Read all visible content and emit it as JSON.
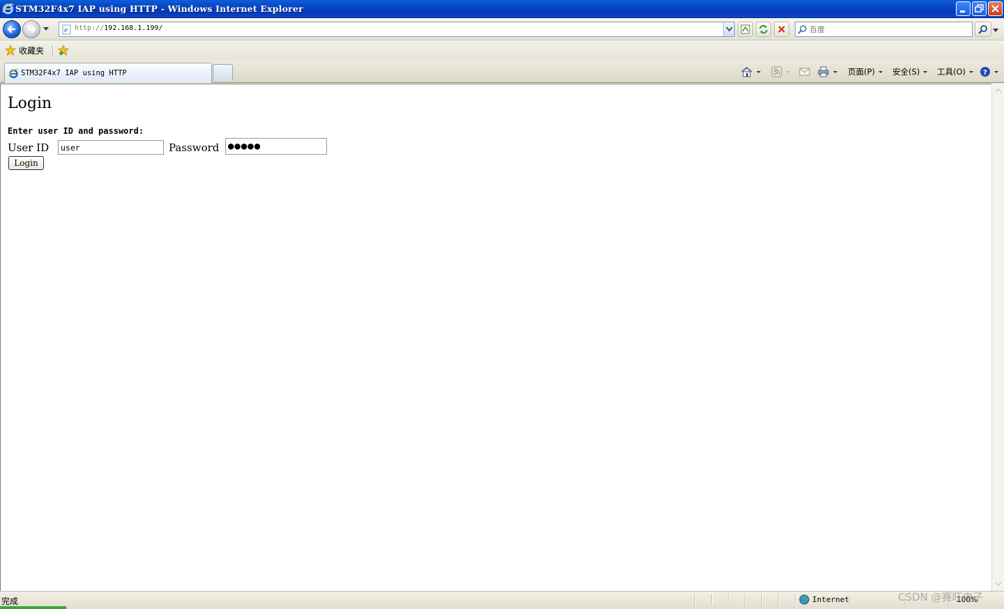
{
  "window": {
    "title": "STM32F4x7 IAP using HTTP - Windows Internet Explorer"
  },
  "navbar": {
    "url_scheme": "http://",
    "url_host": "192.168.1.199/",
    "search_placeholder": "百度"
  },
  "favorites": {
    "label": "收藏夹"
  },
  "tabs": [
    {
      "title": "STM32F4x7 IAP using HTTP"
    }
  ],
  "command_bar": {
    "page_label": "页面(P)",
    "safety_label": "安全(S)",
    "tools_label": "工具(O)"
  },
  "page": {
    "heading": "Login",
    "prompt": "Enter user ID and password:",
    "user_id_label": "User ID",
    "user_id_value": "user",
    "password_label": "Password",
    "password_value": "●●●●●",
    "login_button": "Login"
  },
  "statusbar": {
    "status": "完成",
    "zone": "Internet",
    "zoom": "100%"
  },
  "watermark": "CSDN @赛旺电子",
  "colors": {
    "titlebar": "#0a5fd8",
    "chrome": "#ece9d8",
    "accent": "#0a46c4"
  }
}
